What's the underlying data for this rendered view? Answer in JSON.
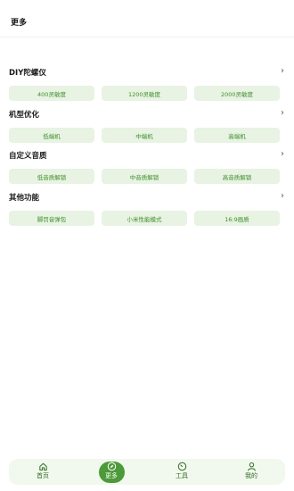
{
  "header": {
    "title": "更多"
  },
  "sections": [
    {
      "title": "DIY陀螺仪",
      "arrow": "›",
      "buttons": [
        "400灵敏度",
        "1200灵敏度",
        "2000灵敏度"
      ]
    },
    {
      "title": "机型优化",
      "arrow": "›",
      "buttons": [
        "低端机",
        "中端机",
        "高端机"
      ]
    },
    {
      "title": "自定义音质",
      "arrow": "›",
      "buttons": [
        "低音质解锁",
        "中音质解锁",
        "高音质解锁"
      ]
    },
    {
      "title": "其他功能",
      "arrow": "›",
      "buttons": [
        "脚罚音弹包",
        "小米性能模式",
        "16:9画质"
      ]
    }
  ],
  "tabbar": {
    "items": [
      {
        "label": "首页",
        "icon": "home-icon"
      },
      {
        "label": "更多",
        "icon": "compass-icon",
        "active": true
      },
      {
        "label": "工具",
        "icon": "gauge-icon"
      },
      {
        "label": "我的",
        "icon": "user-icon"
      }
    ]
  },
  "colors": {
    "accent": "#4c9a3a",
    "chip_bg": "#e8f3e3",
    "chip_text": "#3f8f2c"
  }
}
